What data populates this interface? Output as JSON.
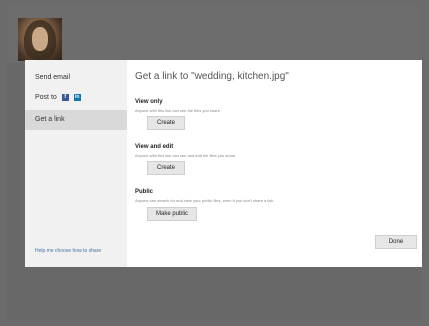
{
  "sidebar": {
    "items": [
      {
        "label": "Send email"
      },
      {
        "label": "Post to"
      },
      {
        "label": "Get a link"
      }
    ],
    "footer": "Help me choose how to share"
  },
  "dialog": {
    "title": "Get a link to \"wedding, kitchen.jpg\"",
    "sections": [
      {
        "title": "View only",
        "desc": "Anyone with this link can see the files you share.",
        "button": "Create"
      },
      {
        "title": "View and edit",
        "desc": "Anyone with this link can see and edit the files you share.",
        "button": "Create"
      },
      {
        "title": "Public",
        "desc": "Anyone can search for and view your public files, even if you don't share a link.",
        "button": "Make public"
      }
    ],
    "done_label": "Done"
  },
  "icons": {
    "facebook": "facebook-icon",
    "linkedin": "linkedin-icon"
  }
}
